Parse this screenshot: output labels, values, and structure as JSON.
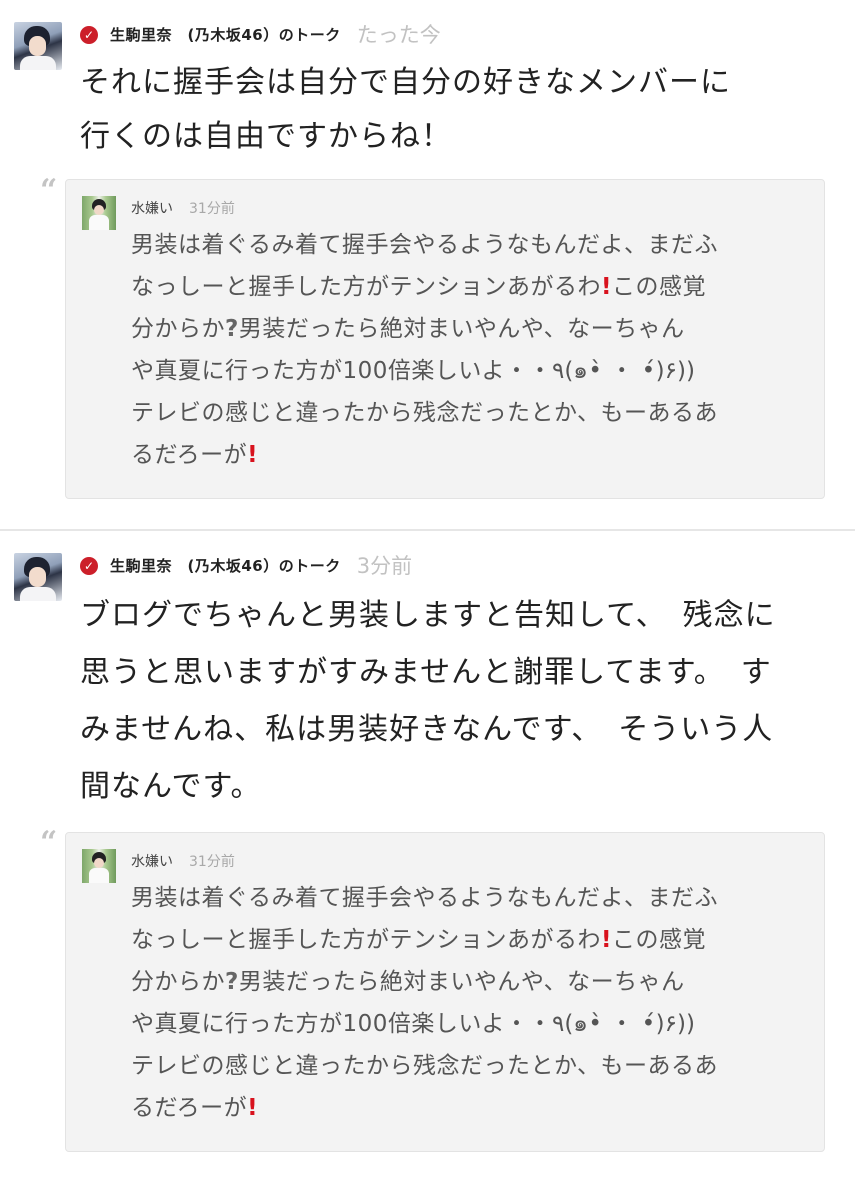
{
  "posts": [
    {
      "author_talk": "生駒里奈　(乃木坂46）のトーク",
      "time": "たった今",
      "body": "それに握手会は自分で自分の好きなメンバーに\n行くのは自由ですからね！",
      "quote": {
        "name": "水嫌い",
        "time": "31分前",
        "lines": [
          {
            "a": "男装は着ぐるみ着て握手会やるようなもんだよ、まだふ",
            "mark": "",
            "b": ""
          },
          {
            "a": "なっしーと握手した方がテンションあがるわ",
            "mark": "!",
            "b": "この感覚"
          },
          {
            "a": "分からか",
            "mark": "?",
            "b": "男装だったら絶対まいやんや、なーちゃん"
          },
          {
            "a": "や真夏に行った方が100倍楽しいよ・・٩(๑•̀ ・ •́)۶))",
            "mark": "",
            "b": ""
          },
          {
            "a": "テレビの感じと違ったから残念だったとか、もーあるあ",
            "mark": "",
            "b": ""
          },
          {
            "a": "るだろーが",
            "mark": "!",
            "b": ""
          }
        ]
      }
    },
    {
      "author_talk": "生駒里奈　(乃木坂46）のトーク",
      "time": "3分前",
      "body": "ブログでちゃんと男装しますと告知して、　残念に\n思うと思いますがすみませんと謝罪してます。　す\nみませんね、私は男装好きなんです、　そういう人\n間なんです。",
      "quote": {
        "name": "水嫌い",
        "time": "31分前",
        "lines": [
          {
            "a": "男装は着ぐるみ着て握手会やるようなもんだよ、まだふ",
            "mark": "",
            "b": ""
          },
          {
            "a": "なっしーと握手した方がテンションあがるわ",
            "mark": "!",
            "b": "この感覚"
          },
          {
            "a": "分からか",
            "mark": "?",
            "b": "男装だったら絶対まいやんや、なーちゃん"
          },
          {
            "a": "や真夏に行った方が100倍楽しいよ・・٩(๑•̀ ・ •́)۶))",
            "mark": "",
            "b": ""
          },
          {
            "a": "テレビの感じと違ったから残念だったとか、もーあるあ",
            "mark": "",
            "b": ""
          },
          {
            "a": "るだろーが",
            "mark": "!",
            "b": ""
          }
        ]
      }
    }
  ],
  "icons": {
    "verified": "check-badge-icon",
    "quote": "quote-mark-icon"
  },
  "colors": {
    "accent": "#cc1f2a",
    "timestamp": "#c2c2c2",
    "quote_bg": "#f3f3f3"
  }
}
